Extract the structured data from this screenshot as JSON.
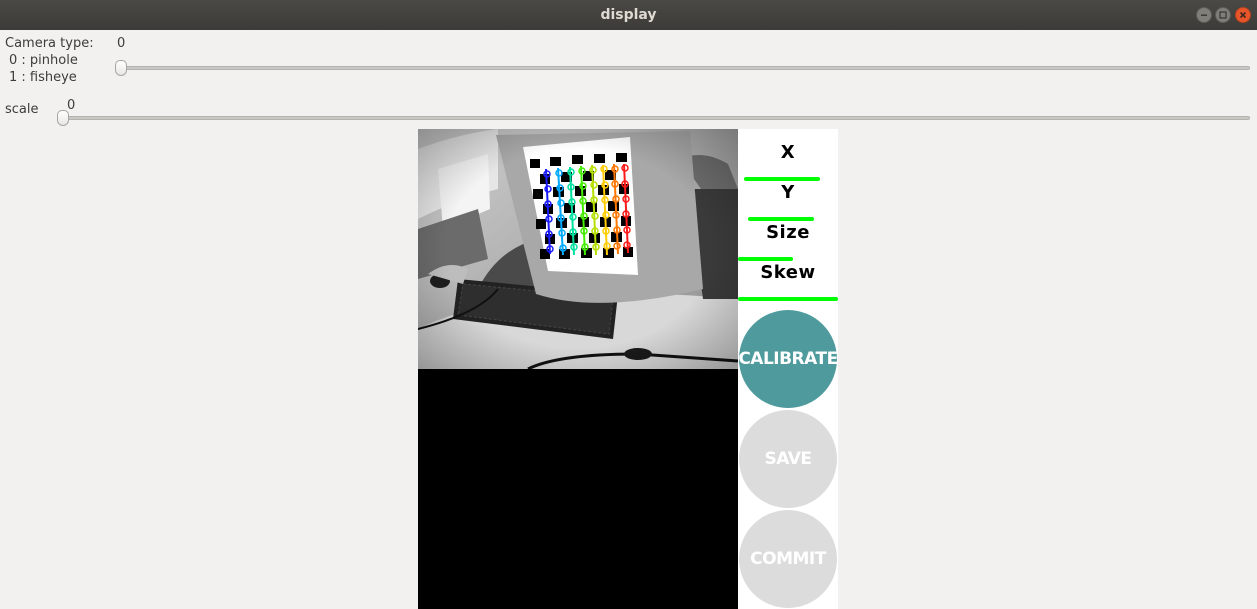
{
  "window": {
    "title": "display"
  },
  "trackbars": {
    "camera_type": {
      "label": "Camera type:",
      "options": [
        "0 : pinhole",
        "1 : fisheye"
      ],
      "value": "0"
    },
    "scale": {
      "label": "scale",
      "value": "0"
    }
  },
  "calibration_panel": {
    "metrics": [
      {
        "label": "X",
        "progress": 0.82
      },
      {
        "label": "Y",
        "progress": 0.76
      },
      {
        "label": "Size",
        "progress": 0.55
      },
      {
        "label": "Skew",
        "progress": 1.0
      }
    ],
    "bar_color": "#00ff00",
    "buttons": {
      "calibrate": {
        "label": "CALIBRATE",
        "color": "#4e9a9c",
        "enabled": true
      },
      "save": {
        "label": "SAVE",
        "color": "#dcdcdc",
        "enabled": false
      },
      "commit": {
        "label": "COMMIT",
        "color": "#dcdcdc",
        "enabled": false
      }
    }
  }
}
